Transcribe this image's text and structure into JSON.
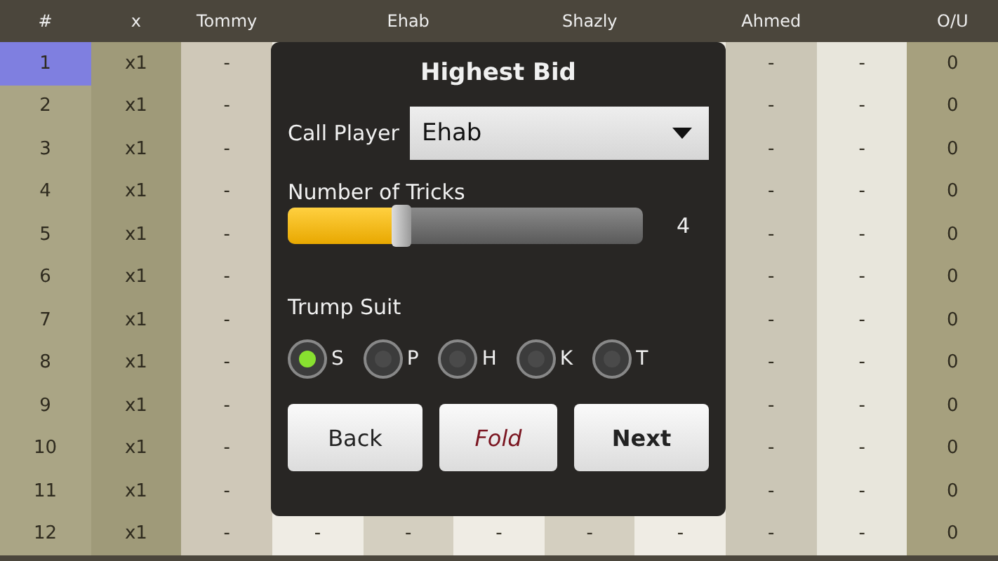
{
  "table": {
    "columns": [
      "#",
      "x",
      "Tommy",
      null,
      "Ehab",
      null,
      "Shazly",
      null,
      "Ahmed",
      null,
      "O/U"
    ],
    "rows": [
      {
        "selected": true,
        "cells": [
          "1",
          "x1",
          "-",
          null,
          null,
          null,
          null,
          null,
          "-",
          "-",
          "0"
        ]
      },
      {
        "selected": false,
        "cells": [
          "2",
          "x1",
          "-",
          null,
          null,
          null,
          null,
          null,
          "-",
          "-",
          "0"
        ]
      },
      {
        "selected": false,
        "cells": [
          "3",
          "x1",
          "-",
          null,
          null,
          null,
          null,
          null,
          "-",
          "-",
          "0"
        ]
      },
      {
        "selected": false,
        "cells": [
          "4",
          "x1",
          "-",
          null,
          null,
          null,
          null,
          null,
          "-",
          "-",
          "0"
        ]
      },
      {
        "selected": false,
        "cells": [
          "5",
          "x1",
          "-",
          null,
          null,
          null,
          null,
          null,
          "-",
          "-",
          "0"
        ]
      },
      {
        "selected": false,
        "cells": [
          "6",
          "x1",
          "-",
          null,
          null,
          null,
          null,
          null,
          "-",
          "-",
          "0"
        ]
      },
      {
        "selected": false,
        "cells": [
          "7",
          "x1",
          "-",
          null,
          null,
          null,
          null,
          null,
          "-",
          "-",
          "0"
        ]
      },
      {
        "selected": false,
        "cells": [
          "8",
          "x1",
          "-",
          null,
          null,
          null,
          null,
          null,
          "-",
          "-",
          "0"
        ]
      },
      {
        "selected": false,
        "cells": [
          "9",
          "x1",
          "-",
          null,
          null,
          null,
          null,
          null,
          "-",
          "-",
          "0"
        ]
      },
      {
        "selected": false,
        "cells": [
          "10",
          "x1",
          "-",
          null,
          null,
          null,
          null,
          null,
          "-",
          "-",
          "0"
        ]
      },
      {
        "selected": false,
        "cells": [
          "11",
          "x1",
          "-",
          null,
          null,
          null,
          null,
          null,
          "-",
          "-",
          "0"
        ]
      },
      {
        "selected": false,
        "cells": [
          "12",
          "x1",
          "-",
          "-",
          "-",
          "-",
          "-",
          "-",
          "-",
          "-",
          "0"
        ]
      }
    ]
  },
  "dialog": {
    "title": "Highest Bid",
    "call_player": {
      "label": "Call Player",
      "value": "Ehab"
    },
    "tricks": {
      "label": "Number of Tricks",
      "level": 0.32,
      "reading": "4"
    },
    "trump": {
      "label": "Trump Suit",
      "options": [
        {
          "label": "S",
          "selected": true
        },
        {
          "label": "P",
          "selected": false
        },
        {
          "label": "H",
          "selected": false
        },
        {
          "label": "K",
          "selected": false
        },
        {
          "label": "T",
          "selected": false
        }
      ]
    },
    "buttons": [
      {
        "label": "Back",
        "kind": "normal"
      },
      {
        "label": "Fold",
        "kind": "danger"
      },
      {
        "label": "Next",
        "kind": "primary"
      }
    ]
  }
}
